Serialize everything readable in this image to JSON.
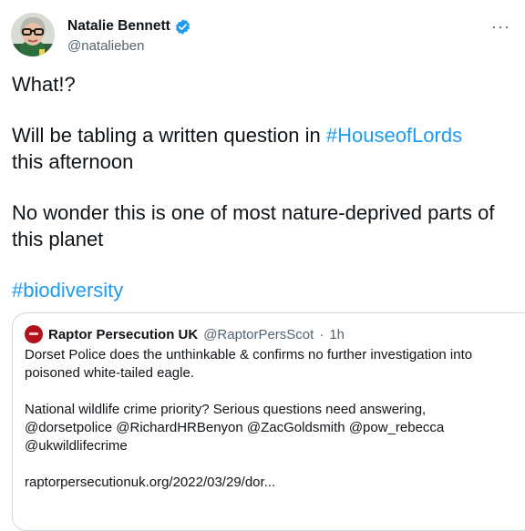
{
  "author": {
    "display_name": "Natalie Bennett",
    "handle": "@natalieben",
    "verified": true,
    "avatar_icon": "person-photo-avatar"
  },
  "menu_icon": "more-options-icon",
  "menu_glyph": "···",
  "tweet": {
    "line1": "What!?",
    "line2_text": "Will be tabling a written question in ",
    "line2_hashtag": "#HouseofLords",
    "line3": "this afternoon",
    "line4": "No wonder this is one of most nature-deprived parts of",
    "line5": "this planet",
    "hashtag": "#biodiversity"
  },
  "quoted": {
    "display_name": "Raptor Persecution UK",
    "handle": "@RaptorPersScot",
    "separator": "·",
    "time": "1h",
    "line1": "Dorset Police does the unthinkable & confirms no further investigation into",
    "line2": "poisoned white-tailed eagle.",
    "line3": "National wildlife crime priority? Serious questions need answering,",
    "line4": "@dorsetpolice @RichardHRBenyon @ZacGoldsmith @pow_rebecca",
    "line5": "@ukwildlifecrime",
    "line6": "raptorpersecutionuk.org/2022/03/29/dor..."
  },
  "colors": {
    "link": "#1d9bf0",
    "secondary_text": "#536471",
    "primary_text": "#0f1419",
    "border": "#cfd9de",
    "quoted_avatar": "#b1121b"
  }
}
